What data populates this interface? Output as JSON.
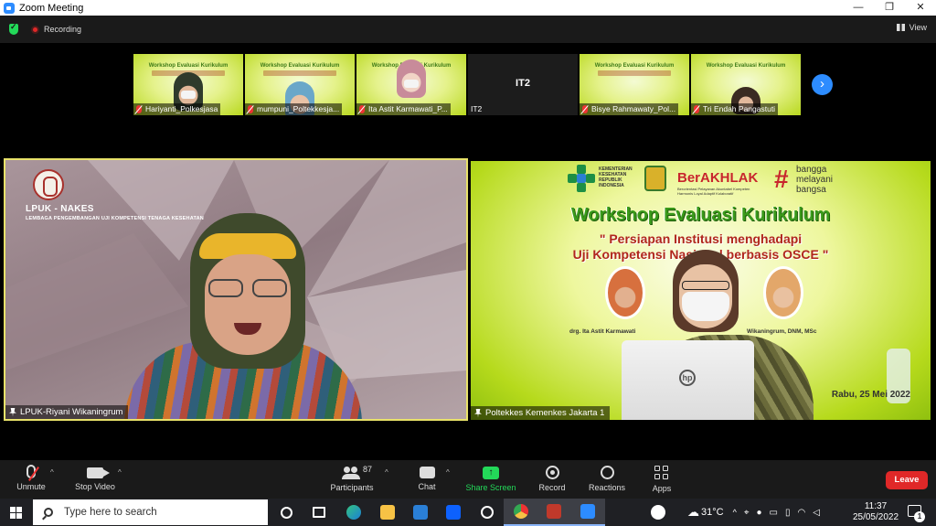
{
  "window": {
    "title": "Zoom Meeting",
    "controls": [
      "minimize",
      "maximize",
      "close"
    ]
  },
  "topbar": {
    "recording_label": "Recording",
    "view_label": "View",
    "security_icon": "shield-check-icon"
  },
  "thumbnails": [
    {
      "name": "Hariyanti_Polkesjasa",
      "muted": true,
      "slide_title": "Workshop Evaluasi Kurikulum"
    },
    {
      "name": "mumpuni_Poltekkesja...",
      "muted": true,
      "slide_title": "Workshop Evaluasi Kurikulum"
    },
    {
      "name": "Ita Astit Karmawati_P...",
      "muted": true,
      "slide_title": "Workshop Evaluasi Kurikulum"
    },
    {
      "name": "IT2",
      "center_name": "IT2",
      "muted": false
    },
    {
      "name": "Bisye Rahmawaty_Pol...",
      "muted": true,
      "slide_title": "Workshop Evaluasi Kurikulum"
    },
    {
      "name": "Tri Endah Pangastuti",
      "muted": true,
      "slide_title": "Workshop Evaluasi Kurikulum"
    }
  ],
  "main_left": {
    "org_name": "LPUK - NAKES",
    "org_subtitle": "LEMBAGA PENGEMBANGAN UJI KOMPETENSI TENAGA KESEHATAN",
    "participant_label": "LPUK-Riyani Wikaningrum"
  },
  "main_right": {
    "kemkes_text": "KEMENTERIAN KESEHATAN REPUBLIK INDONESIA",
    "berakhlak": "BerAKHLAK",
    "berakhlak_sub": "Berorientasi Pelayanan Akuntabel Kompeten Harmonis Loyal Adaptif Kolaboratif",
    "bangga_hash": "#",
    "bangga_lines": [
      "bangga",
      "melayani",
      "bangsa"
    ],
    "workshop_title": "Workshop Evaluasi Kurikulum",
    "subtitle_line1": "\" Persiapan Institusi menghadapi",
    "subtitle_line2": "Uji Kompetensi Nasional berbasis OSCE \"",
    "speaker1_caption": "drg. Ita Astit Karmawati",
    "speaker2_caption": "Wikaningrum, DNM, MSc",
    "event_date": "Rabu, 25 Mei 2022",
    "laptop_logo": "hp",
    "participant_label": "Poltekkes Kemenkes Jakarta 1"
  },
  "toolbar": {
    "unmute": "Unmute",
    "stop_video": "Stop Video",
    "participants": "Participants",
    "participants_count": "87",
    "chat": "Chat",
    "share_screen": "Share Screen",
    "record": "Record",
    "reactions": "Reactions",
    "apps": "Apps",
    "leave": "Leave"
  },
  "taskbar": {
    "search_placeholder": "Type here to search",
    "weather": "31°C",
    "time": "11:37",
    "date": "25/05/2022",
    "notification_count": "1"
  },
  "colors": {
    "zoom_blue": "#2d8cff",
    "share_green": "#23d959",
    "leave_red": "#e02828",
    "active_speaker_border": "#e8e26a",
    "slide_green": "#b6da1c"
  }
}
